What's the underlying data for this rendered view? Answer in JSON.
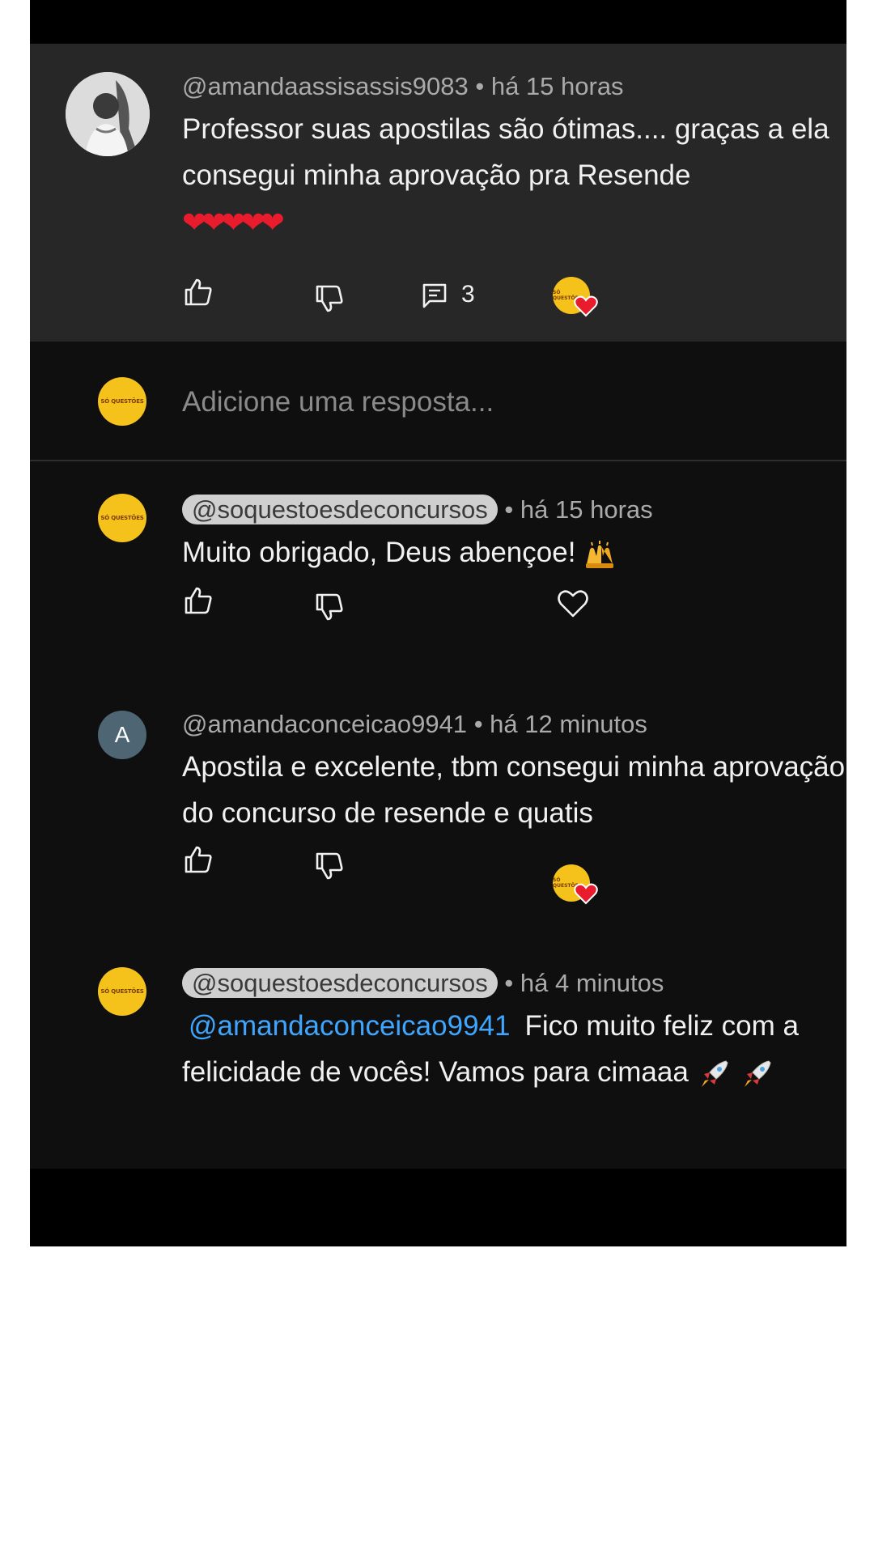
{
  "main_comment": {
    "handle": "@amandaassisassis9083",
    "separator": "•",
    "time": "há 15 horas",
    "text": "Professor suas apostilas são ótimas.... graças a ela consegui minha aprovação pra Resende",
    "hearts": "❤❤❤❤❤",
    "reply_count": "3",
    "icons": [
      "like-icon",
      "dislike-icon",
      "replies-icon",
      "creator-heart-icon"
    ]
  },
  "reply_box": {
    "placeholder": "Adicione uma resposta..."
  },
  "replies": [
    {
      "handle": "@soquestoesdeconcursos",
      "separator": "•",
      "time": "há 15 horas",
      "text": "Muito obrigado, Deus abençoe!",
      "emoji": "raising-hands-icon",
      "hearted": false
    },
    {
      "avatar_letter": "A",
      "handle": "@amandaconceicao9941",
      "separator": "•",
      "time": "há 12 minutos",
      "text": "Apostila e excelente, tbm consegui minha aprovação do concurso de resende e quatis",
      "hearted": true
    },
    {
      "handle": "@soquestoesdeconcursos",
      "separator": "•",
      "time": "há 4 minutos",
      "mention": "@amandaconceicao9941",
      "text": "Fico muito feliz com a felicidade de vocês! Vamos para cimaaa",
      "emoji": "rocket-icon"
    }
  ],
  "brand_logo_text": "SÓ QUESTÕES",
  "colors": {
    "background": "#0f0f0f",
    "highlight": "#272727",
    "mention": "#3ea6ff",
    "brand": "#f4c21a",
    "heart": "#e81c2c"
  }
}
